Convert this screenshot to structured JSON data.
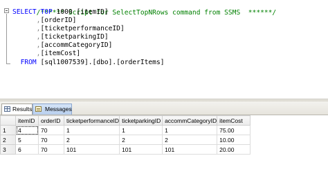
{
  "editor": {
    "comment": "/****** Script for SelectTopNRows command from SSMS  ******/",
    "select_kw": "SELECT",
    "top_kw": "TOP",
    "top_value": "1000",
    "columns": [
      "[itemID]",
      "[orderID]",
      "[ticketperformanceID]",
      "[ticketparkingID]",
      "[accommCategoryID]",
      "[itemCost]"
    ],
    "from_kw": "FROM",
    "from_target": "[sql1007539].[dbo].[orderItems]"
  },
  "result_tabs": [
    {
      "label": "Results",
      "icon": "grid-icon",
      "active": true
    },
    {
      "label": "Messages",
      "icon": "messages-icon",
      "active": false
    }
  ],
  "results": {
    "columns": [
      "itemID",
      "orderID",
      "ticketperformanceID",
      "ticketparkingID",
      "accommCategoryID",
      "itemCost"
    ],
    "rows": [
      {
        "num": "1",
        "cells": [
          "4",
          "70",
          "1",
          "1",
          "1",
          "75.00"
        ]
      },
      {
        "num": "2",
        "cells": [
          "5",
          "70",
          "2",
          "2",
          "2",
          "10.00"
        ]
      },
      {
        "num": "3",
        "cells": [
          "6",
          "70",
          "101",
          "101",
          "101",
          "20.00"
        ]
      }
    ]
  }
}
